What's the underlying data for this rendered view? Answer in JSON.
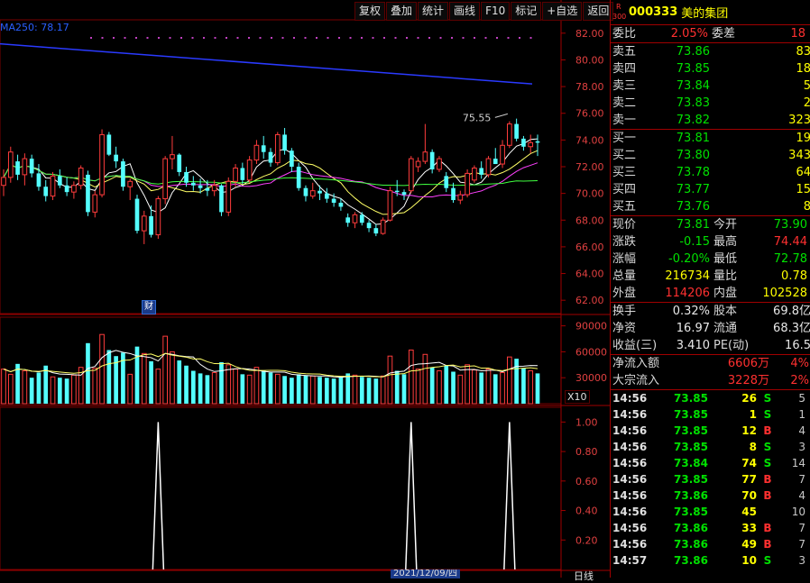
{
  "toolbar": [
    "复权",
    "叠加",
    "统计",
    "画线",
    "F10",
    "标记",
    "+自选",
    "返回"
  ],
  "ma_label": "MA250: 78.17",
  "annotation": "75.55",
  "finance_badge": "财",
  "x10": "X10",
  "date_tag": "2021/12/09/四",
  "day_label": "日线",
  "price_axis": [
    "82.00",
    "80.00",
    "78.00",
    "76.00",
    "74.00",
    "72.00",
    "70.00",
    "68.00",
    "66.00",
    "64.00",
    "62.00"
  ],
  "volume_axis": [
    "90000",
    "60000",
    "30000"
  ],
  "indicator_axis": [
    "1.00",
    "0.80",
    "0.60",
    "0.40",
    "0.20"
  ],
  "stock": {
    "badge": "R\n300",
    "code": "000333",
    "name": "美的集团"
  },
  "weibi": {
    "label1": "委比",
    "value1": "2.05%",
    "label2": "委差",
    "value2": "18"
  },
  "sells": [
    {
      "label": "卖五",
      "price": "73.86",
      "vol": "83"
    },
    {
      "label": "卖四",
      "price": "73.85",
      "vol": "18"
    },
    {
      "label": "卖三",
      "price": "73.84",
      "vol": "5"
    },
    {
      "label": "卖二",
      "price": "73.83",
      "vol": "2"
    },
    {
      "label": "卖一",
      "price": "73.82",
      "vol": "323"
    }
  ],
  "buys": [
    {
      "label": "买一",
      "price": "73.81",
      "vol": "19"
    },
    {
      "label": "买二",
      "price": "73.80",
      "vol": "343"
    },
    {
      "label": "买三",
      "price": "73.78",
      "vol": "64"
    },
    {
      "label": "买四",
      "price": "73.77",
      "vol": "15"
    },
    {
      "label": "买五",
      "price": "73.76",
      "vol": "8"
    }
  ],
  "quote": [
    {
      "l1": "现价",
      "v1": "73.81",
      "c1": "green",
      "l2": "今开",
      "v2": "73.90",
      "c2": "green"
    },
    {
      "l1": "涨跌",
      "v1": "-0.15",
      "c1": "green",
      "l2": "最高",
      "v2": "74.44",
      "c2": "red"
    },
    {
      "l1": "涨幅",
      "v1": "-0.20%",
      "c1": "green",
      "l2": "最低",
      "v2": "72.78",
      "c2": "green"
    },
    {
      "l1": "总量",
      "v1": "216734",
      "c1": "yellow",
      "l2": "量比",
      "v2": "0.78",
      "c2": "yellow"
    },
    {
      "l1": "外盘",
      "v1": "114206",
      "c1": "red",
      "l2": "内盘",
      "v2": "102528",
      "c2": "yellow"
    }
  ],
  "stats": [
    {
      "l1": "换手",
      "v1": "0.32%",
      "l2": "股本",
      "v2": "69.8亿"
    },
    {
      "l1": "净资",
      "v1": "16.97",
      "l2": "流通",
      "v2": "68.3亿"
    },
    {
      "l1": "收益(三)",
      "v1": "3.410",
      "l2": "PE(动)",
      "v2": "16.5"
    }
  ],
  "flows": [
    {
      "label": "净流入额",
      "amount": "6606万",
      "pct": "4%"
    },
    {
      "label": "大宗流入",
      "amount": "3228万",
      "pct": "2%"
    }
  ],
  "ticks": [
    {
      "time": "14:56",
      "price": "73.85",
      "vol": "26",
      "side": "S",
      "n": "5"
    },
    {
      "time": "14:56",
      "price": "73.85",
      "vol": "1",
      "side": "S",
      "n": "1"
    },
    {
      "time": "14:56",
      "price": "73.85",
      "vol": "12",
      "side": "B",
      "n": "4"
    },
    {
      "time": "14:56",
      "price": "73.85",
      "vol": "8",
      "side": "S",
      "n": "3"
    },
    {
      "time": "14:56",
      "price": "73.84",
      "vol": "74",
      "side": "S",
      "n": "14"
    },
    {
      "time": "14:56",
      "price": "73.85",
      "vol": "77",
      "side": "B",
      "n": "7"
    },
    {
      "time": "14:56",
      "price": "73.86",
      "vol": "70",
      "side": "B",
      "n": "4"
    },
    {
      "time": "14:56",
      "price": "73.85",
      "vol": "45",
      "side": "",
      "n": "10"
    },
    {
      "time": "14:56",
      "price": "73.86",
      "vol": "33",
      "side": "B",
      "n": "7"
    },
    {
      "time": "14:56",
      "price": "73.86",
      "vol": "49",
      "side": "B",
      "n": "7"
    },
    {
      "time": "14:57",
      "price": "73.86",
      "vol": "10",
      "side": "S",
      "n": "3"
    }
  ],
  "chart_data": {
    "type": "candlestick",
    "price_range": [
      61,
      83
    ],
    "volume_range": [
      0,
      100000
    ],
    "indicator_range": [
      0,
      1.1
    ],
    "candles": [
      [
        70.6,
        71.8,
        69.8,
        71.2
      ],
      [
        71.2,
        73.5,
        70.8,
        73.1
      ],
      [
        72.4,
        72.9,
        71.0,
        71.4
      ],
      [
        71.4,
        73.0,
        70.6,
        72.6
      ],
      [
        72.6,
        72.9,
        71.2,
        71.5
      ],
      [
        71.5,
        72.2,
        70.2,
        70.5
      ],
      [
        70.5,
        71.0,
        69.4,
        69.8
      ],
      [
        69.8,
        71.6,
        69.5,
        71.3
      ],
      [
        71.3,
        71.8,
        70.4,
        70.6
      ],
      [
        70.6,
        71.2,
        69.8,
        70.1
      ],
      [
        70.1,
        70.9,
        69.6,
        70.6
      ],
      [
        70.6,
        72.1,
        70.3,
        71.9
      ],
      [
        71.4,
        71.7,
        68.3,
        68.6
      ],
      [
        68.6,
        70.2,
        68.2,
        69.9
      ],
      [
        69.9,
        74.8,
        69.7,
        74.4
      ],
      [
        74.4,
        74.6,
        72.8,
        72.9
      ],
      [
        72.9,
        73.5,
        71.9,
        72.4
      ],
      [
        72.4,
        72.6,
        70.2,
        70.5
      ],
      [
        70.5,
        71.1,
        69.5,
        70.9
      ],
      [
        69.6,
        69.9,
        67.0,
        67.2
      ],
      [
        67.2,
        68.7,
        66.2,
        68.3
      ],
      [
        68.3,
        69.1,
        66.7,
        66.9
      ],
      [
        66.9,
        69.8,
        66.6,
        69.6
      ],
      [
        69.6,
        72.8,
        69.2,
        72.6
      ],
      [
        72.6,
        74.3,
        71.8,
        72.9
      ],
      [
        72.9,
        73.0,
        71.3,
        71.6
      ],
      [
        71.6,
        72.0,
        70.5,
        70.8
      ],
      [
        70.8,
        71.3,
        70.2,
        70.6
      ],
      [
        70.6,
        71.1,
        70.0,
        70.4
      ],
      [
        70.4,
        71.0,
        69.8,
        70.2
      ],
      [
        70.2,
        71.0,
        69.8,
        70.6
      ],
      [
        70.6,
        70.7,
        68.3,
        68.6
      ],
      [
        68.6,
        71.2,
        68.3,
        70.9
      ],
      [
        70.9,
        72.2,
        70.5,
        71.9
      ],
      [
        71.9,
        72.3,
        70.7,
        71.0
      ],
      [
        71.0,
        72.8,
        70.8,
        72.5
      ],
      [
        72.5,
        74.0,
        72.2,
        73.6
      ],
      [
        73.6,
        74.3,
        72.6,
        73.1
      ],
      [
        73.1,
        73.4,
        72.0,
        72.3
      ],
      [
        72.3,
        74.6,
        72.1,
        74.4
      ],
      [
        74.4,
        74.9,
        72.9,
        73.2
      ],
      [
        73.2,
        73.4,
        71.6,
        72.0
      ],
      [
        72.0,
        72.3,
        70.2,
        70.4
      ],
      [
        70.4,
        70.6,
        69.4,
        69.8
      ],
      [
        69.8,
        70.8,
        69.6,
        70.2
      ],
      [
        70.2,
        70.6,
        69.5,
        70.0
      ],
      [
        70.0,
        70.4,
        69.3,
        69.6
      ],
      [
        69.6,
        70.0,
        69.0,
        69.3
      ],
      [
        69.3,
        69.6,
        68.7,
        69.0
      ],
      [
        68.2,
        68.5,
        67.5,
        67.8
      ],
      [
        67.8,
        68.6,
        67.4,
        68.4
      ],
      [
        68.4,
        68.6,
        67.6,
        67.8
      ],
      [
        67.8,
        68.0,
        67.1,
        67.4
      ],
      [
        67.4,
        67.7,
        66.8,
        67.0
      ],
      [
        67.0,
        68.2,
        66.9,
        68.0
      ],
      [
        68.0,
        70.5,
        67.9,
        70.2
      ],
      [
        70.2,
        71.0,
        69.8,
        70.1
      ],
      [
        70.1,
        70.3,
        69.5,
        69.9
      ],
      [
        70.2,
        72.8,
        70.0,
        72.6
      ],
      [
        72.0,
        72.7,
        71.6,
        72.4
      ],
      [
        72.4,
        75.2,
        72.2,
        73.1
      ],
      [
        73.1,
        73.3,
        71.5,
        71.8
      ],
      [
        71.8,
        72.8,
        71.6,
        72.6
      ],
      [
        71.3,
        71.6,
        70.1,
        70.4
      ],
      [
        70.4,
        70.8,
        69.3,
        69.5
      ],
      [
        69.5,
        70.2,
        69.2,
        69.9
      ],
      [
        69.9,
        71.8,
        69.7,
        71.5
      ],
      [
        71.0,
        72.1,
        70.8,
        71.9
      ],
      [
        71.9,
        72.4,
        71.1,
        71.4
      ],
      [
        71.4,
        72.8,
        71.2,
        72.6
      ],
      [
        72.6,
        73.4,
        72.2,
        72.2
      ],
      [
        72.2,
        74.0,
        71.9,
        73.6
      ],
      [
        73.6,
        75.4,
        73.4,
        75.2
      ],
      [
        75.2,
        75.6,
        73.9,
        74.1
      ],
      [
        74.1,
        74.3,
        73.2,
        73.5
      ],
      [
        73.5,
        74.4,
        73.0,
        73.8
      ],
      [
        73.9,
        74.4,
        72.8,
        73.8
      ]
    ],
    "volume": [
      40000,
      34000,
      46000,
      38000,
      30000,
      36000,
      44000,
      31000,
      30000,
      29000,
      33000,
      42000,
      70000,
      41000,
      80000,
      62000,
      55000,
      59000,
      34000,
      66000,
      58000,
      49000,
      40000,
      78000,
      60000,
      50000,
      44000,
      38000,
      35000,
      33000,
      36000,
      48000,
      45000,
      40000,
      34000,
      33000,
      42000,
      38000,
      36000,
      34000,
      32000,
      30000,
      34000,
      33000,
      32000,
      31000,
      30000,
      29000,
      31000,
      35000,
      33000,
      31000,
      30000,
      29000,
      32000,
      55000,
      38000,
      34000,
      62000,
      40000,
      57000,
      42000,
      38000,
      44000,
      37000,
      33000,
      45000,
      39000,
      36000,
      40000,
      34000,
      36000,
      54000,
      52000,
      41000,
      38000,
      35000
    ],
    "indicator_spikes": [
      {
        "index": 22,
        "value": 1.0
      },
      {
        "index": 58,
        "value": 1.0
      },
      {
        "index": 72,
        "value": 1.0
      }
    ],
    "ma250": [
      81.2,
      78.2
    ],
    "annotation_value": 75.55
  }
}
